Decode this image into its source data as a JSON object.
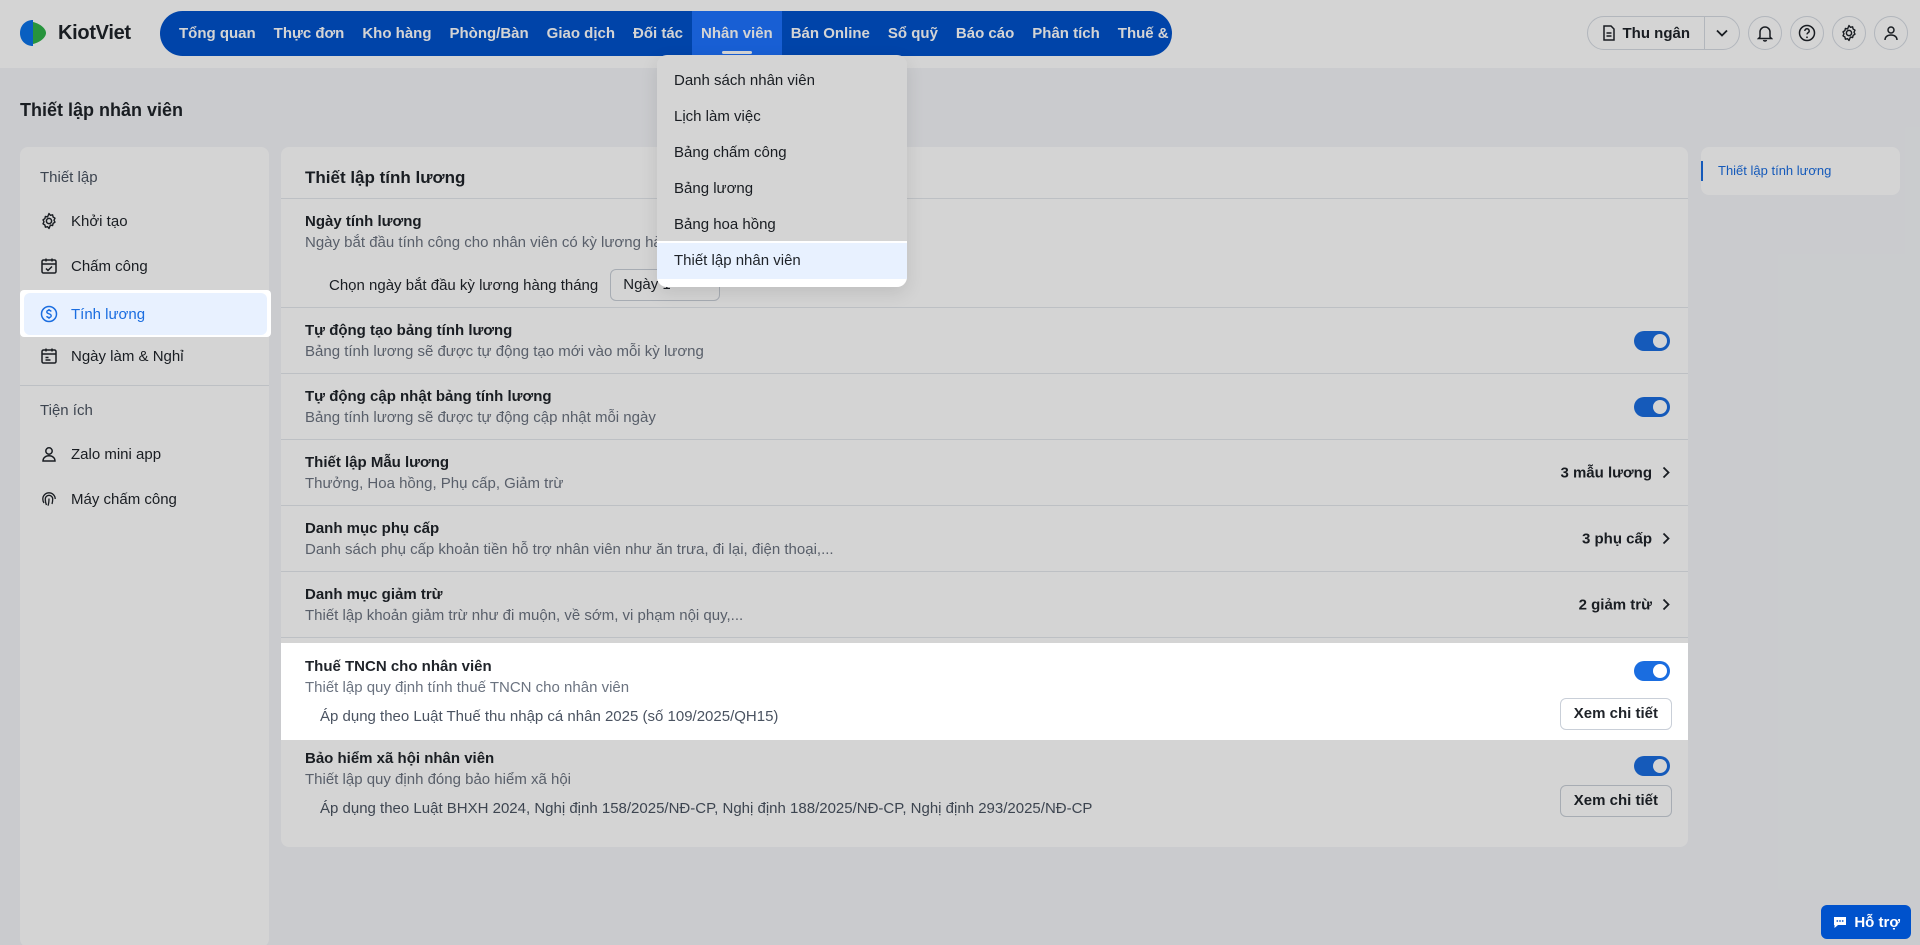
{
  "brand": {
    "name": "KiotViet"
  },
  "nav": {
    "items": [
      "Tổng quan",
      "Thực đơn",
      "Kho hàng",
      "Phòng/Bàn",
      "Giao dịch",
      "Đối tác",
      "Nhân viên",
      "Bán Online",
      "Sổ quỹ",
      "Báo cáo",
      "Phân tích",
      "Thuế & Kế toán"
    ],
    "active": "Nhân viên"
  },
  "toolbar": {
    "cashier_label": "Thu ngân"
  },
  "page": {
    "title": "Thiết lập nhân viên"
  },
  "sidebar": {
    "group1": "Thiết lập",
    "items1": [
      {
        "label": "Khởi tạo",
        "icon": "gear-icon"
      },
      {
        "label": "Chấm công",
        "icon": "calendar-check-icon"
      },
      {
        "label": "Tính lương",
        "icon": "dollar-circle-icon",
        "active": true
      },
      {
        "label": "Ngày làm & Nghỉ",
        "icon": "calendar-icon"
      }
    ],
    "group2": "Tiện ích",
    "items2": [
      {
        "label": "Zalo mini app",
        "icon": "user-icon"
      },
      {
        "label": "Máy chấm công",
        "icon": "fingerprint-icon"
      }
    ]
  },
  "content": {
    "title": "Thiết lập tính lương",
    "payday": {
      "title": "Ngày tính lương",
      "desc": "Ngày bắt đầu tính công cho nhân viên có kỳ lương hàng tháng",
      "select_label": "Chọn ngày bắt đầu kỳ lương hàng tháng",
      "select_value": "Ngày 1"
    },
    "rows": [
      {
        "title": "Tự động tạo bảng tính lương",
        "desc": "Bảng tính lương sẽ được tự động tạo mới vào mỗi kỳ lương",
        "toggle": true
      },
      {
        "title": "Tự động cập nhật bảng tính lương",
        "desc": "Bảng tính lương sẽ được tự động cập nhật mỗi ngày",
        "toggle": true
      },
      {
        "title": "Thiết lập Mẫu lương",
        "desc": "Thưởng, Hoa hồng, Phụ cấp, Giảm trừ",
        "right": "3 mẫu lương"
      },
      {
        "title": "Danh mục phụ cấp",
        "desc": "Danh sách phụ cấp khoản tiền hỗ trợ nhân viên như ăn trưa, đi lại, điện thoại,...",
        "right": "3 phụ cấp"
      },
      {
        "title": "Danh mục giảm trừ",
        "desc": "Thiết lập khoản giảm trừ như đi muộn, về sớm, vi phạm nội quy,...",
        "right": "2 giảm trừ"
      }
    ],
    "tax": {
      "title": "Thuế TNCN cho nhân viên",
      "desc": "Thiết lập quy định tính thuế TNCN cho nhân viên",
      "sub": "Áp dụng theo Luật Thuế thu nhập cá nhân 2025 (số 109/2025/QH15)",
      "button": "Xem chi tiết",
      "toggle": true
    },
    "insurance": {
      "title": "Bảo hiểm xã hội nhân viên",
      "desc": "Thiết lập quy định đóng bảo hiểm xã hội",
      "sub": "Áp dụng theo Luật BHXH 2024, Nghị định 158/2025/NĐ-CP, Nghị định 188/2025/NĐ-CP, Nghị định 293/2025/NĐ-CP",
      "button": "Xem chi tiết",
      "toggle": true
    }
  },
  "rightnav": {
    "item": "Thiết lập tính lương"
  },
  "dropdown": {
    "items": [
      "Danh sách nhân viên",
      "Lịch làm việc",
      "Bảng chấm công",
      "Bảng lương",
      "Bảng hoa hồng",
      "Thiết lập nhân viên"
    ],
    "active": "Thiết lập nhân viên"
  },
  "help": {
    "label": "Hỗ trợ"
  },
  "colors": {
    "brand": "#0052cc",
    "accent": "#1a6de0",
    "active_bg": "#e8f1ff"
  }
}
